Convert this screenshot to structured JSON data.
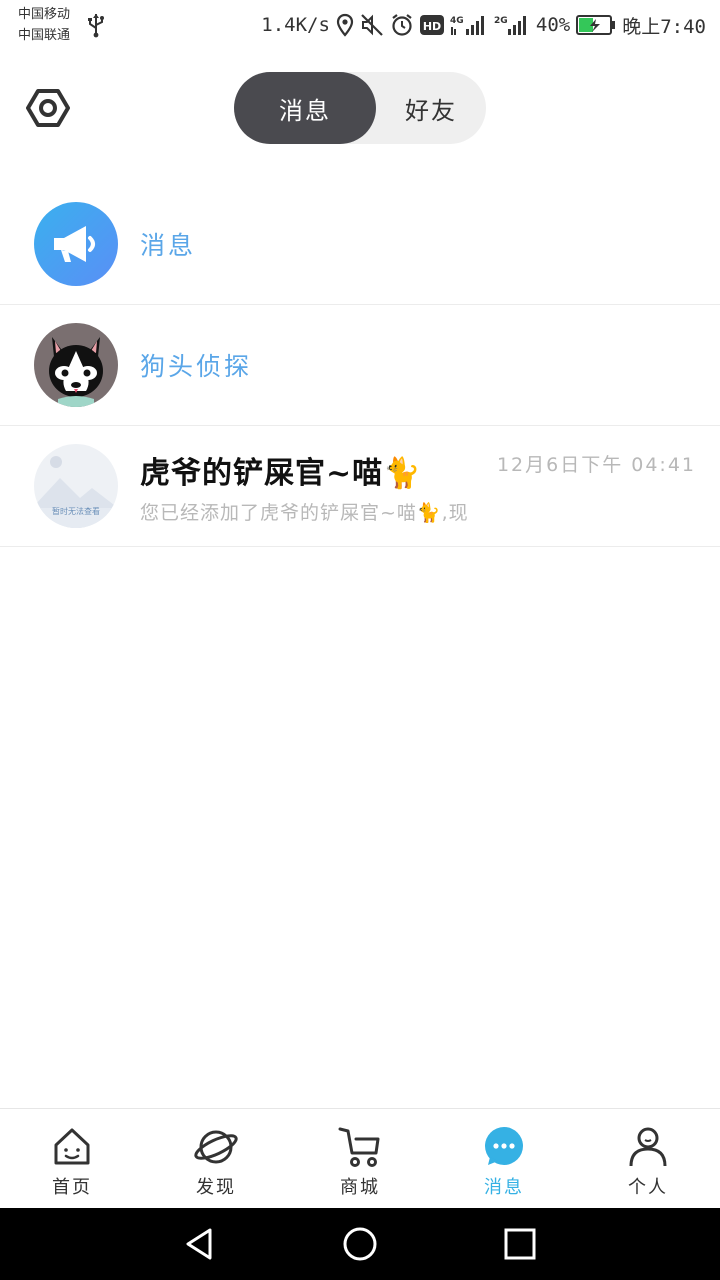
{
  "status_bar": {
    "carrier_1": "中国移动",
    "carrier_2": "中国联通",
    "net_speed": "1.4K/s",
    "hd_badge": "HD",
    "net_4g": "4G",
    "net_2g": "2G",
    "battery": "40%",
    "time": "晚上7:40"
  },
  "header": {
    "tab_messages": "消息",
    "tab_friends": "好友",
    "active_tab": "消息"
  },
  "list": [
    {
      "label": "消息",
      "icon": "megaphone-icon"
    },
    {
      "label": "狗头侦探",
      "icon": "husky-avatar"
    },
    {
      "name": "虎爷的铲屎官~喵🐈",
      "time": "12月6日下午 04:41",
      "preview": "您已经添加了虎爷的铲屎官~喵🐈,现",
      "avatar_text": "暂时无法查看"
    }
  ],
  "tabbar": {
    "items": [
      {
        "label": "首页",
        "icon": "home-icon"
      },
      {
        "label": "发现",
        "icon": "planet-icon"
      },
      {
        "label": "商城",
        "icon": "cart-icon"
      },
      {
        "label": "消息",
        "icon": "chat-bubble-icon"
      },
      {
        "label": "个人",
        "icon": "person-icon"
      }
    ],
    "active": "消息"
  },
  "colors": {
    "accent": "#35b1e4",
    "link_blue": "#5aa6e8",
    "segment_active": "#4a4a4f"
  }
}
